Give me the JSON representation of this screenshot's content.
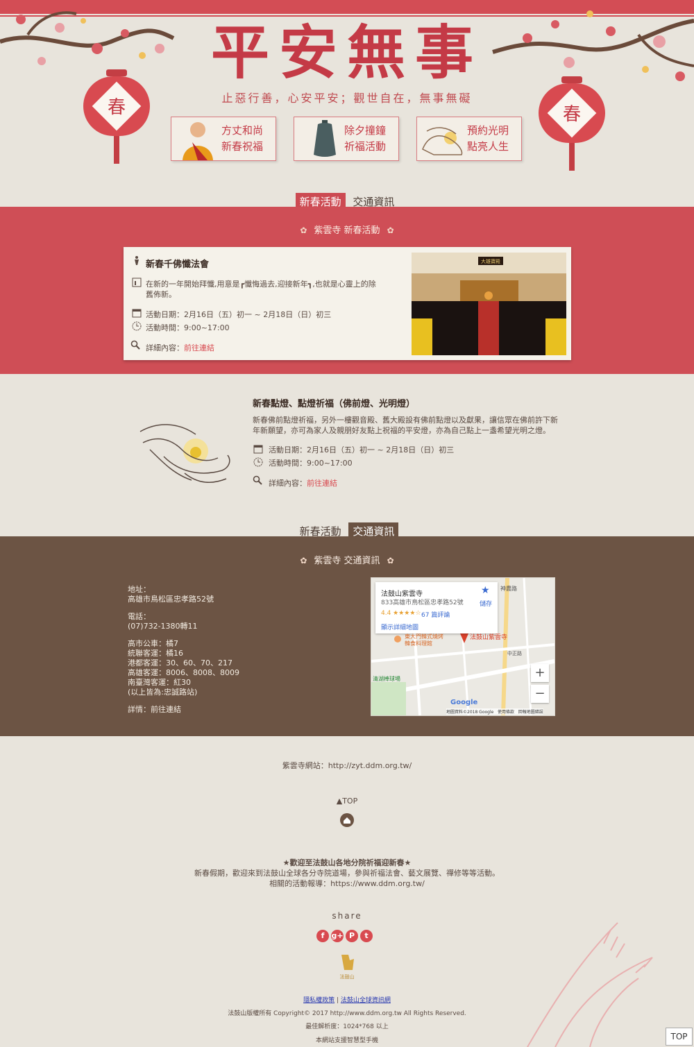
{
  "header": {
    "title": "平安無事",
    "subtitle": "止惡行善，心安平安；觀世自在，無事無礙",
    "lantern_char": "春",
    "cards": [
      {
        "label": "方丈和尚\n新春祝福"
      },
      {
        "label": "除夕撞鐘\n祈福活動"
      },
      {
        "label": "預約光明\n點亮人生"
      }
    ]
  },
  "tabs_top": {
    "activity": "新春活動",
    "traffic": "交通資訊"
  },
  "activity_section": {
    "band_title": "紫雲寺 新春活動",
    "event1": {
      "title": "新春千佛懺法會",
      "desc": "在新的一年開始拜懺,用意是┏懺悔過去,迎接新年┓,也就是心靈上的除舊佈新。",
      "date": "活動日期：2月16日（五）初一 ~ 2月18日（日）初三",
      "time": "活動時間：9:00~17:00",
      "detail_label": "詳細內容：",
      "detail_link": "前往連結",
      "photo_sign": "大雄寶殿"
    },
    "event2": {
      "title": "新春點燈、點燈祈福（佛前燈、光明燈）",
      "desc": "新春佛前點燈祈福，另外一樓觀音殿、舊大殿設有佛前點燈以及獻果，讓信眾在佛前許下新年新願望，亦可為家人及親朋好友點上祝福的平安燈，亦為自己點上一盞希望光明之燈。",
      "date": "活動日期：2月16日（五）初一 ~ 2月18日（日）初三",
      "time": "活動時間：9:00~17:00",
      "detail_label": "詳細內容：",
      "detail_link": "前往連結"
    }
  },
  "tabs_mid": {
    "activity": "新春活動",
    "traffic": "交通資訊"
  },
  "traffic_section": {
    "band_title": "紫雲寺 交通資訊",
    "address_label": "地址：",
    "address": "高雄市鳥松區忠孝路52號",
    "phone_label": "電話：",
    "phone": "(07)732-1380轉11",
    "bus_lines": [
      "高市公車：橘7",
      "統聯客運：橘16",
      "港都客運：30、60、70、217",
      "高雄客運：8006、8008、8009",
      "南臺灣客運：紅30",
      "(以上皆為:忠誠路站)"
    ],
    "detail": "詳情：前往連結",
    "map": {
      "place_name": "法鼓山紫雲寺",
      "place_address": "833高雄市鳥松區忠孝路52號",
      "rating": "4.4 ★★★★☆",
      "reviews": "67 篇評論",
      "save": "儲存",
      "larger_map": "顯示詳細地圖",
      "pin_label": "法鼓山紫雲寺",
      "poi1": "東大門韓式燒烤\n韓食料理館",
      "poi2": "清湖棒球場",
      "road1": "神農路",
      "road2": "中正路",
      "zoom_in": "+",
      "zoom_out": "−",
      "google": "Google",
      "attribution": "地圖資料©2018 Google   使用條款   回報地圖錯誤"
    }
  },
  "footer": {
    "website": "紫雲寺網站：http://zyt.ddm.org.tw/",
    "top_link": "▲TOP",
    "welcome_title": "★歡迎至法鼓山各地分院祈福迎新春★",
    "welcome_line1": "新春假期，歡迎來到法鼓山全球各分寺院道場，參與祈福法會、藝文展覽、禪修等等活動。",
    "welcome_line2": "相關的活動報導：https://www.ddm.org.tw/",
    "share": "share",
    "social": [
      "f",
      "g+",
      "P",
      "t"
    ],
    "logo_text": "法鼓山",
    "privacy": "隱私權政策",
    "separator": "|",
    "global": "法鼓山全球資訊網",
    "copyright": "法鼓山版權所有 Copyright© 2017 http://www.ddm.org.tw All Rights Reserved.",
    "resolution": "最佳解析度：1024*768 以上",
    "mobile": "本網站支援智慧型手機",
    "top_button": "TOP"
  },
  "colors": {
    "red": "#cf4e56",
    "brown": "#6c5444",
    "paper": "#e8e4dc"
  }
}
